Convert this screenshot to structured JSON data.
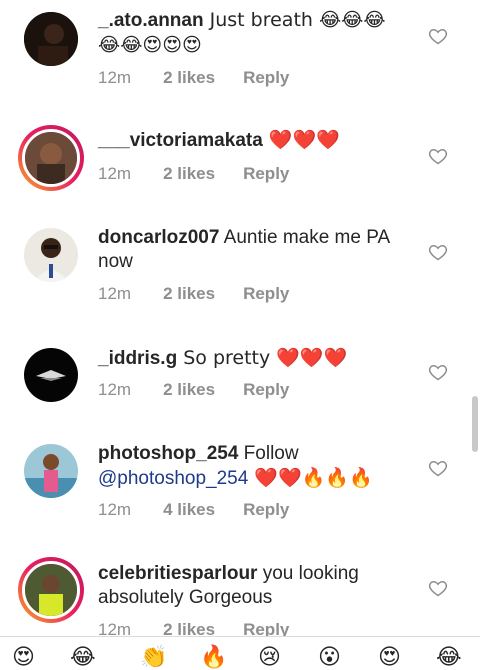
{
  "comments": [
    {
      "username": "_.ato.annan",
      "text": " Just breath 😂😂😂 😂😂😍😍😍",
      "time": "12m",
      "likes": "2 likes",
      "reply": "Reply",
      "avatar_color": "#2a1a12",
      "story_ring": false
    },
    {
      "username": "___victoriamakata",
      "text": " ❤️❤️❤️",
      "time": "12m",
      "likes": "2 likes",
      "reply": "Reply",
      "avatar_color": "#5a3a2a",
      "story_ring": true
    },
    {
      "username": "doncarloz007",
      "text": " Auntie make me PA now",
      "time": "12m",
      "likes": "2 likes",
      "reply": "Reply",
      "avatar_color": "#e9e5df",
      "story_ring": false
    },
    {
      "username": "_iddris.g",
      "text": " So pretty ❤️❤️❤️",
      "time": "12m",
      "likes": "2 likes",
      "reply": "Reply",
      "avatar_color": "#0b0b0b",
      "story_ring": false
    },
    {
      "username": "photoshop_254",
      "text_before": " Follow ",
      "mention": "@photoshop_254",
      "text_after": " ❤️❤️🔥🔥🔥",
      "time": "12m",
      "likes": "4 likes",
      "reply": "Reply",
      "avatar_color": "#7fb3c8",
      "story_ring": false
    },
    {
      "username": "celebritiesparlour",
      "text": " you looking absolutely Gorgeous",
      "time": "12m",
      "likes": "2 likes",
      "reply": "Reply",
      "avatar_color": "#3d4a2a",
      "story_ring": true
    }
  ],
  "bottom_emojis": [
    "😍",
    "😂",
    "👏",
    "🔥",
    "😢",
    "😮",
    "😍",
    "😂"
  ],
  "colors": {
    "meta": "#8e8e8e",
    "text": "#262626",
    "mention": "#1e3a8a",
    "ring_start": "#f9a825",
    "ring_end": "#c2185b"
  },
  "icons": [
    "heart-outline-icon"
  ]
}
